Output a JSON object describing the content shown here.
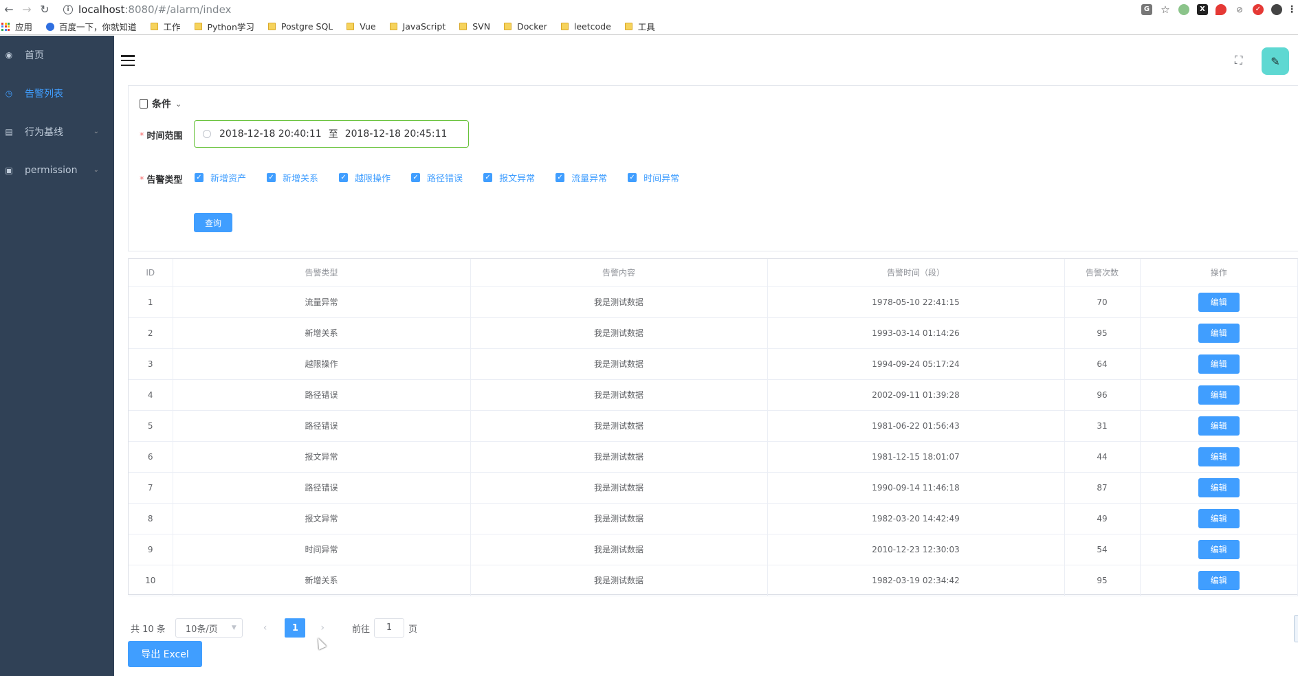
{
  "browser": {
    "url_host": "localhost",
    "url_rest": ":8080/#/alarm/index",
    "bookmarks": [
      {
        "label": "应用"
      },
      {
        "label": "百度一下，你就知道"
      },
      {
        "label": "工作"
      },
      {
        "label": "Python学习"
      },
      {
        "label": "Postgre SQL"
      },
      {
        "label": "Vue"
      },
      {
        "label": "JavaScript"
      },
      {
        "label": "SVN"
      },
      {
        "label": "Docker"
      },
      {
        "label": "leetcode"
      },
      {
        "label": "工具"
      }
    ]
  },
  "sidebar": {
    "items": [
      {
        "label": "首页",
        "icon": "dashboard-icon",
        "active": false
      },
      {
        "label": "告警列表",
        "icon": "alarm-clock-icon",
        "active": true
      },
      {
        "label": "行为基线",
        "icon": "chart-icon",
        "active": false,
        "has_children": true
      },
      {
        "label": "permission",
        "icon": "lock-icon",
        "active": false,
        "has_children": true
      }
    ]
  },
  "search": {
    "section_title": "条件",
    "time_range_label": "时间范围",
    "time_start": "2018-12-18 20:40:11",
    "time_separator": "至",
    "time_end": "2018-12-18 20:45:11",
    "alarm_type_label": "告警类型",
    "alarm_types": [
      {
        "label": "新增资产",
        "checked": true
      },
      {
        "label": "新增关系",
        "checked": true
      },
      {
        "label": "越限操作",
        "checked": true
      },
      {
        "label": "路径错误",
        "checked": true
      },
      {
        "label": "报文异常",
        "checked": true
      },
      {
        "label": "流量异常",
        "checked": true
      },
      {
        "label": "时间异常",
        "checked": true
      }
    ],
    "query_label": "查询"
  },
  "table": {
    "columns": [
      "ID",
      "告警类型",
      "告警内容",
      "告警时间（段）",
      "告警次数",
      "操作"
    ],
    "edit_label": "编辑",
    "rows": [
      {
        "id": "1",
        "type": "流量异常",
        "content": "我是测试数据",
        "time": "1978-05-10 22:41:15",
        "count": "70"
      },
      {
        "id": "2",
        "type": "新增关系",
        "content": "我是测试数据",
        "time": "1993-03-14 01:14:26",
        "count": "95"
      },
      {
        "id": "3",
        "type": "越限操作",
        "content": "我是测试数据",
        "time": "1994-09-24 05:17:24",
        "count": "64"
      },
      {
        "id": "4",
        "type": "路径错误",
        "content": "我是测试数据",
        "time": "2002-09-11 01:39:28",
        "count": "96"
      },
      {
        "id": "5",
        "type": "路径错误",
        "content": "我是测试数据",
        "time": "1981-06-22 01:56:43",
        "count": "31"
      },
      {
        "id": "6",
        "type": "报文异常",
        "content": "我是测试数据",
        "time": "1981-12-15 18:01:07",
        "count": "44"
      },
      {
        "id": "7",
        "type": "路径错误",
        "content": "我是测试数据",
        "time": "1990-09-14 11:46:18",
        "count": "87"
      },
      {
        "id": "8",
        "type": "报文异常",
        "content": "我是测试数据",
        "time": "1982-03-20 14:42:49",
        "count": "49"
      },
      {
        "id": "9",
        "type": "时间异常",
        "content": "我是测试数据",
        "time": "2010-12-23 12:30:03",
        "count": "54"
      },
      {
        "id": "10",
        "type": "新增关系",
        "content": "我是测试数据",
        "time": "1982-03-19 02:34:42",
        "count": "95"
      }
    ]
  },
  "pagination": {
    "total": "共 10 条",
    "page_size": "10条/页",
    "current_page": "1",
    "goto_prefix": "前往",
    "goto_value": "1",
    "goto_suffix": "页"
  },
  "export_label": "导出 Excel",
  "colors": {
    "primary": "#409eff",
    "sidebar_bg": "#304156",
    "avatar_bg": "#5ed8d2"
  }
}
